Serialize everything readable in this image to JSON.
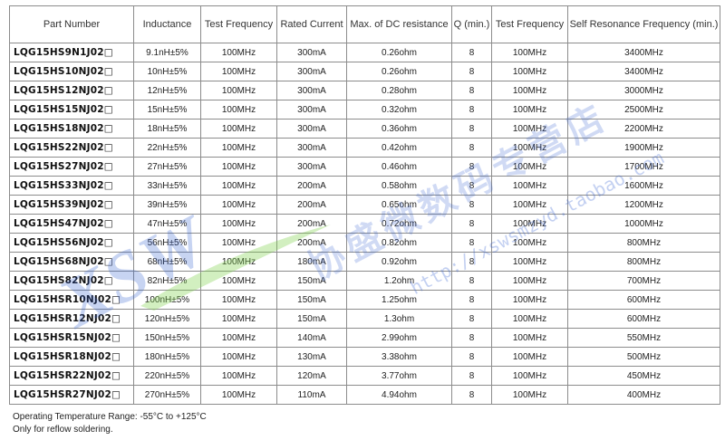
{
  "table": {
    "headers": [
      "Part Number",
      "Inductance",
      "Test Frequency",
      "Rated Current",
      "Max. of DC resistance",
      "Q (min.)",
      "Test Frequency",
      "Self Resonance Frequency (min.)"
    ],
    "rows": [
      [
        "LQG15HS9N1J02□",
        "9.1nH±5%",
        "100MHz",
        "300mA",
        "0.26ohm",
        "8",
        "100MHz",
        "3400MHz"
      ],
      [
        "LQG15HS10NJ02□",
        "10nH±5%",
        "100MHz",
        "300mA",
        "0.26ohm",
        "8",
        "100MHz",
        "3400MHz"
      ],
      [
        "LQG15HS12NJ02□",
        "12nH±5%",
        "100MHz",
        "300mA",
        "0.28ohm",
        "8",
        "100MHz",
        "3000MHz"
      ],
      [
        "LQG15HS15NJ02□",
        "15nH±5%",
        "100MHz",
        "300mA",
        "0.32ohm",
        "8",
        "100MHz",
        "2500MHz"
      ],
      [
        "LQG15HS18NJ02□",
        "18nH±5%",
        "100MHz",
        "300mA",
        "0.36ohm",
        "8",
        "100MHz",
        "2200MHz"
      ],
      [
        "LQG15HS22NJ02□",
        "22nH±5%",
        "100MHz",
        "300mA",
        "0.42ohm",
        "8",
        "100MHz",
        "1900MHz"
      ],
      [
        "LQG15HS27NJ02□",
        "27nH±5%",
        "100MHz",
        "300mA",
        "0.46ohm",
        "8",
        "100MHz",
        "1700MHz"
      ],
      [
        "LQG15HS33NJ02□",
        "33nH±5%",
        "100MHz",
        "200mA",
        "0.58ohm",
        "8",
        "100MHz",
        "1600MHz"
      ],
      [
        "LQG15HS39NJ02□",
        "39nH±5%",
        "100MHz",
        "200mA",
        "0.65ohm",
        "8",
        "100MHz",
        "1200MHz"
      ],
      [
        "LQG15HS47NJ02□",
        "47nH±5%",
        "100MHz",
        "200mA",
        "0.72ohm",
        "8",
        "100MHz",
        "1000MHz"
      ],
      [
        "LQG15HS56NJ02□",
        "56nH±5%",
        "100MHz",
        "200mA",
        "0.82ohm",
        "8",
        "100MHz",
        "800MHz"
      ],
      [
        "LQG15HS68NJ02□",
        "68nH±5%",
        "100MHz",
        "180mA",
        "0.92ohm",
        "8",
        "100MHz",
        "800MHz"
      ],
      [
        "LQG15HS82NJ02□",
        "82nH±5%",
        "100MHz",
        "150mA",
        "1.2ohm",
        "8",
        "100MHz",
        "700MHz"
      ],
      [
        "LQG15HSR10NJ02□",
        "100nH±5%",
        "100MHz",
        "150mA",
        "1.25ohm",
        "8",
        "100MHz",
        "600MHz"
      ],
      [
        "LQG15HSR12NJ02□",
        "120nH±5%",
        "100MHz",
        "150mA",
        "1.3ohm",
        "8",
        "100MHz",
        "600MHz"
      ],
      [
        "LQG15HSR15NJ02□",
        "150nH±5%",
        "100MHz",
        "140mA",
        "2.99ohm",
        "8",
        "100MHz",
        "550MHz"
      ],
      [
        "LQG15HSR18NJ02□",
        "180nH±5%",
        "100MHz",
        "130mA",
        "3.38ohm",
        "8",
        "100MHz",
        "500MHz"
      ],
      [
        "LQG15HSR22NJ02□",
        "220nH±5%",
        "100MHz",
        "120mA",
        "3.77ohm",
        "8",
        "100MHz",
        "450MHz"
      ],
      [
        "LQG15HSR27NJ02□",
        "270nH±5%",
        "100MHz",
        "110mA",
        "4.94ohm",
        "8",
        "100MHz",
        "400MHz"
      ]
    ]
  },
  "notes": [
    "Operating Temperature Range: -55°C to +125°C",
    "Only for reflow soldering."
  ],
  "watermark": {
    "logo_text": "XSW",
    "chinese_text": "协盛微数码专营店",
    "url_text": "http://xswsmzyd.taobao.com",
    "color": "#2c5bd0"
  }
}
